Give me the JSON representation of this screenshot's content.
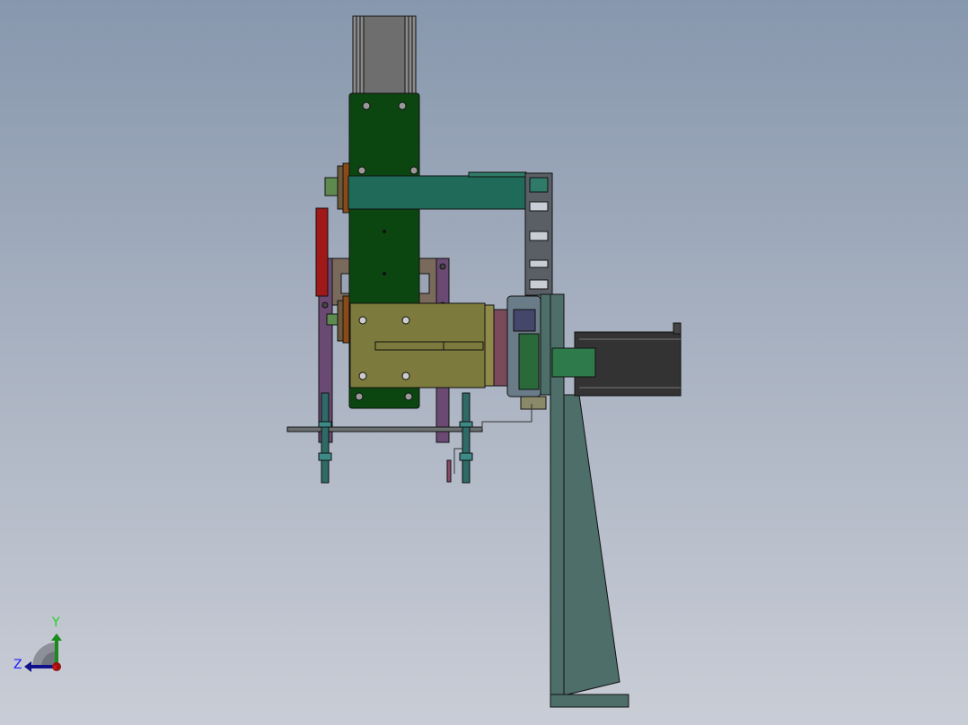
{
  "viewport": {
    "background_top": "#8797ad",
    "background_bottom": "#c9cdd6"
  },
  "triad": {
    "y_label": "Y",
    "z_label": "Z",
    "x_color": "#d01010",
    "y_color": "#1a8a1a",
    "z_color": "#10108a"
  },
  "model_colors": {
    "plate": "#0b4510",
    "beam": "#1f6a58",
    "carriage": "#7c7a3c",
    "frame": "#6a4a72",
    "column": "#4d6e69",
    "motor": "#333333",
    "bracket": "#a01818"
  }
}
